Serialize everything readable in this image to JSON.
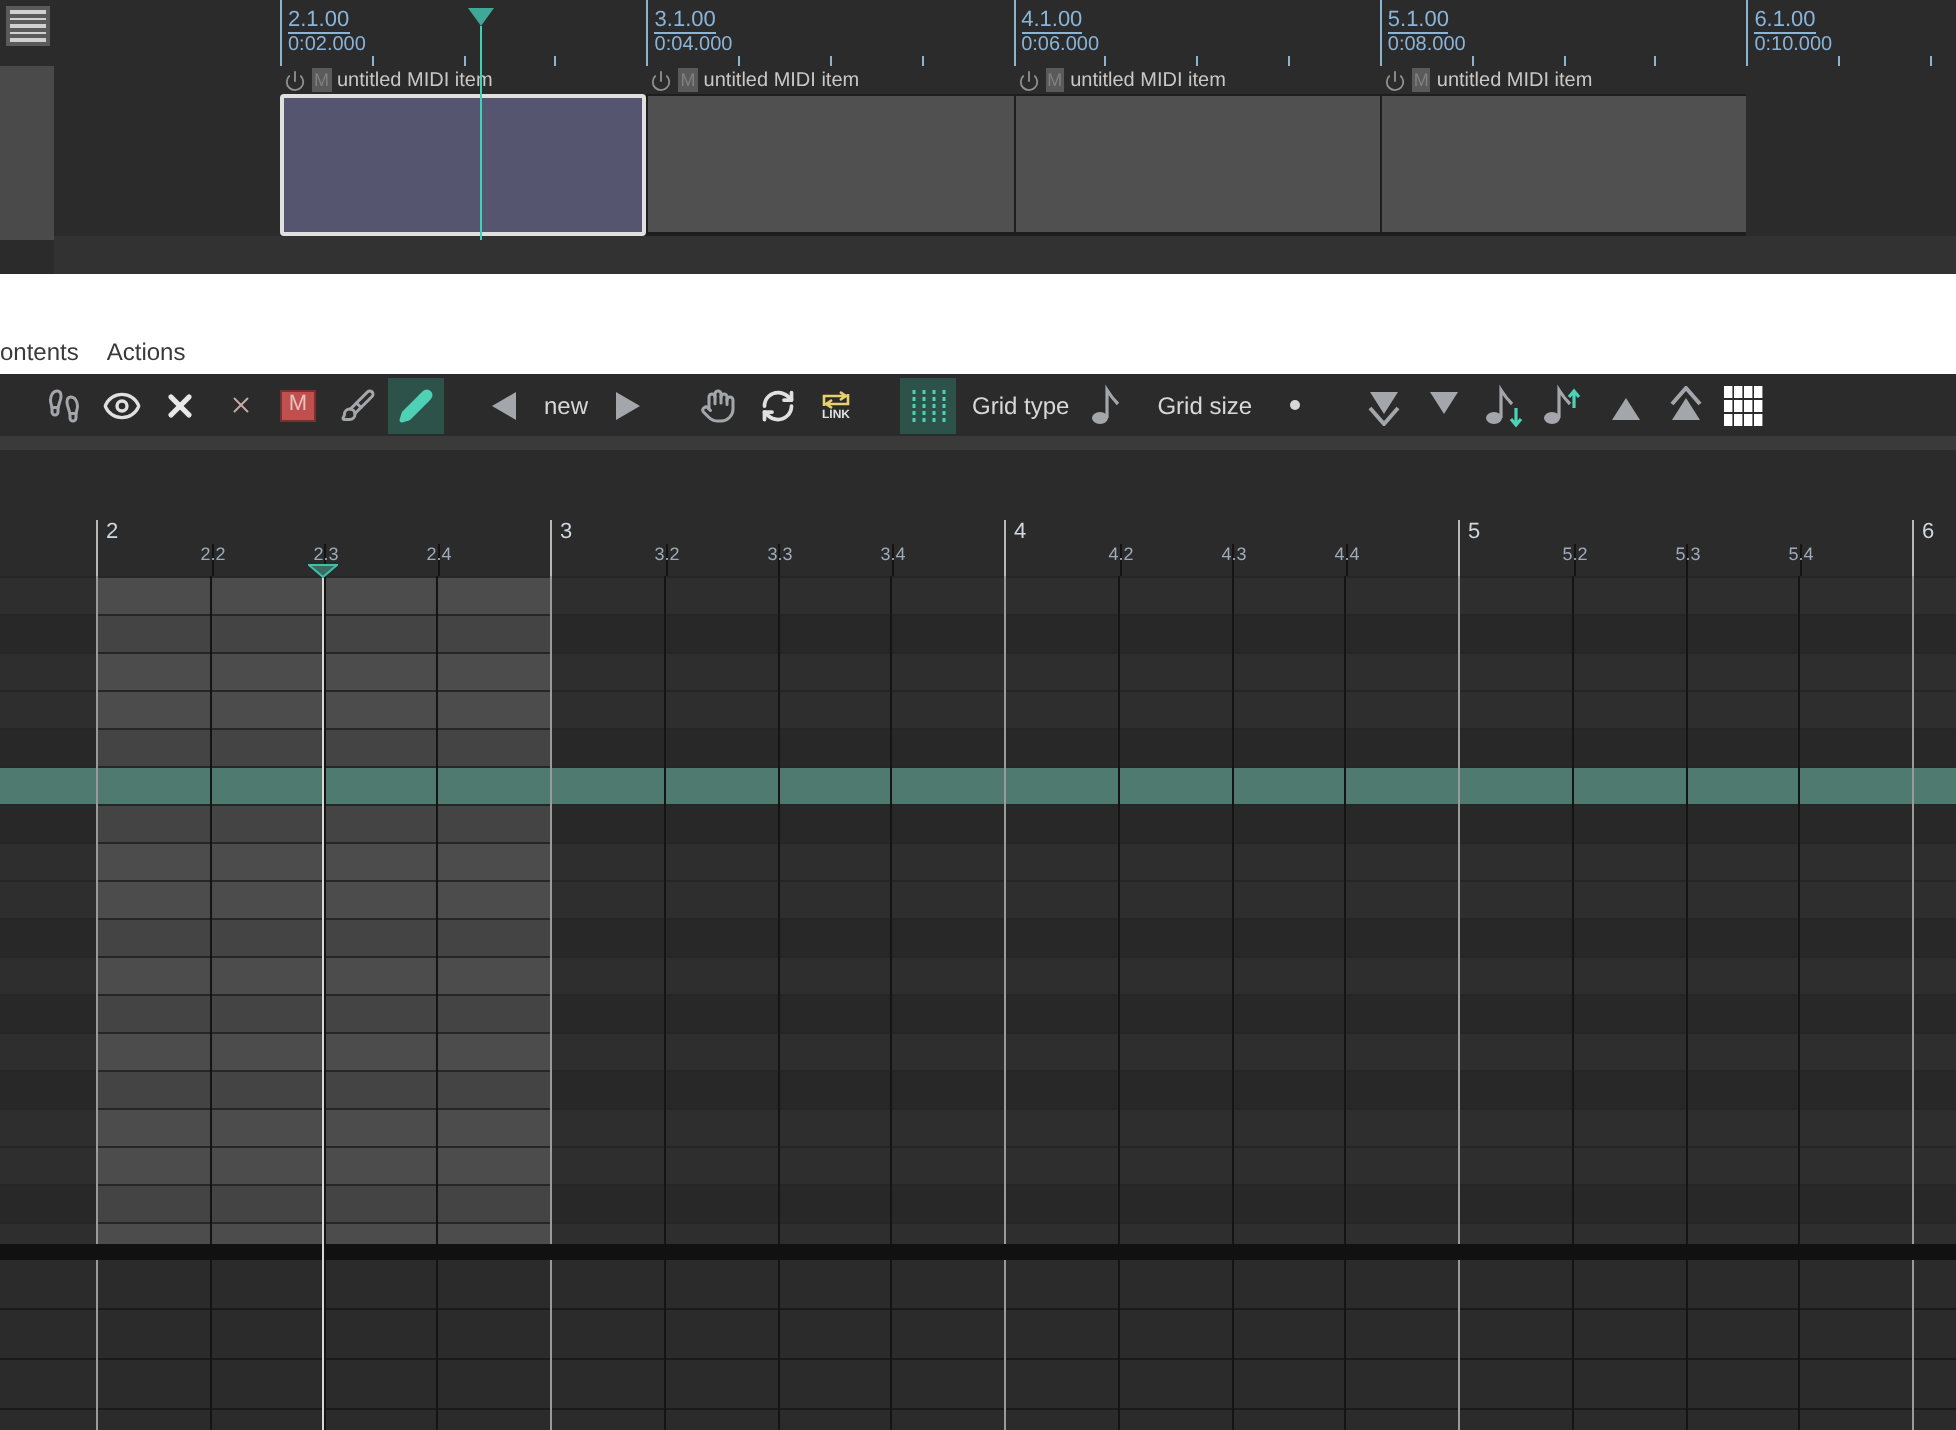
{
  "arrange": {
    "ruler": [
      {
        "bar": "2.1.00",
        "time": "0:02.000"
      },
      {
        "bar": "3.1.00",
        "time": "0:04.000"
      },
      {
        "bar": "4.1.00",
        "time": "0:06.000"
      },
      {
        "bar": "5.1.00",
        "time": "0:08.000"
      },
      {
        "bar": "6.1.00",
        "time": "0:10.000"
      }
    ],
    "items": [
      {
        "title": "untitled MIDI item",
        "mute_badge": "M",
        "selected": true
      },
      {
        "title": "untitled MIDI item",
        "mute_badge": "M",
        "selected": false
      },
      {
        "title": "untitled MIDI item",
        "mute_badge": "M",
        "selected": false
      },
      {
        "title": "untitled MIDI item",
        "mute_badge": "M",
        "selected": false
      }
    ]
  },
  "menu": [
    {
      "label": "ontents"
    },
    {
      "label": "Actions"
    }
  ],
  "toolbar": [
    {
      "kind": "steps",
      "active": false
    },
    {
      "kind": "eye",
      "active": false
    },
    {
      "kind": "close",
      "active": false
    },
    {
      "kind": "delete",
      "active": false
    },
    {
      "kind": "mute",
      "label": "M",
      "active": false
    },
    {
      "kind": "brush",
      "active": false
    },
    {
      "kind": "pencil",
      "active": true
    },
    {
      "kind": "prev",
      "active": false
    },
    {
      "kind": "text",
      "label": "new"
    },
    {
      "kind": "next",
      "active": false
    },
    {
      "kind": "hand",
      "active": false
    },
    {
      "kind": "swap",
      "active": false
    },
    {
      "kind": "link",
      "label": "LINK",
      "active": false
    },
    {
      "kind": "grid",
      "active": true
    },
    {
      "kind": "text",
      "label": "Grid type"
    },
    {
      "kind": "note",
      "active": false
    },
    {
      "kind": "text",
      "label": "Grid size"
    },
    {
      "kind": "dot",
      "active": false
    },
    {
      "kind": "down2",
      "active": false
    },
    {
      "kind": "down",
      "active": false
    },
    {
      "kind": "notedown",
      "active": false
    },
    {
      "kind": "noteup",
      "active": false
    },
    {
      "kind": "up",
      "active": false
    },
    {
      "kind": "up2",
      "active": false
    },
    {
      "kind": "keys",
      "active": false
    }
  ],
  "piano_roll": {
    "ruler": [
      {
        "bar": "2",
        "beats": [
          "2.2",
          "2.3",
          "2.4"
        ]
      },
      {
        "bar": "3",
        "beats": [
          "3.2",
          "3.3",
          "3.4"
        ]
      },
      {
        "bar": "4",
        "beats": [
          "4.2",
          "4.3",
          "4.4"
        ]
      },
      {
        "bar": "5",
        "beats": [
          "5.2",
          "5.3",
          "5.4"
        ]
      },
      {
        "bar": "6"
      }
    ],
    "rows": [
      {
        "kind": "white",
        "selected": false
      },
      {
        "kind": "black",
        "selected": false
      },
      {
        "kind": "white",
        "selected": false
      },
      {
        "kind": "white",
        "selected": false
      },
      {
        "kind": "black",
        "selected": false
      },
      {
        "kind": "white",
        "selected": true
      },
      {
        "kind": "black",
        "selected": false
      },
      {
        "kind": "white",
        "selected": false
      },
      {
        "kind": "white",
        "selected": false
      },
      {
        "kind": "black",
        "selected": false
      },
      {
        "kind": "white",
        "selected": false
      },
      {
        "kind": "black",
        "selected": false
      },
      {
        "kind": "white",
        "selected": false
      },
      {
        "kind": "black",
        "selected": false
      },
      {
        "kind": "white",
        "selected": false
      },
      {
        "kind": "white",
        "selected": false
      },
      {
        "kind": "black",
        "selected": false
      },
      {
        "kind": "white",
        "selected": false
      }
    ]
  }
}
